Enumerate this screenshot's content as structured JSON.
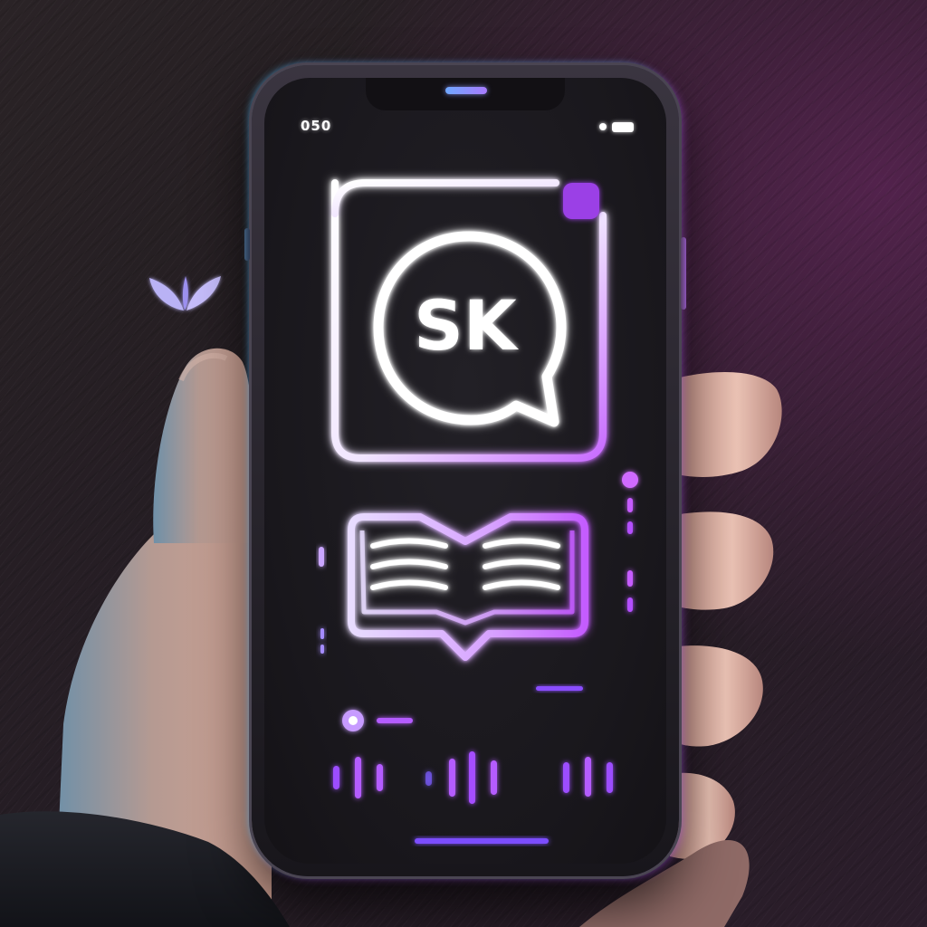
{
  "status_bar": {
    "time": "050"
  },
  "app_icon": {
    "logo_text": "SK",
    "icon": "chat-bubble-icon"
  },
  "content": {
    "icon": "open-book-chat-icon"
  },
  "audio": {
    "icon": "audio-waveform-icon"
  },
  "colors": {
    "neon_white": "#ffffff",
    "neon_purple": "#b45cff",
    "neon_violet": "#8a4dff",
    "neon_blue": "#6fa8ff",
    "background": "#231d21"
  },
  "brand": {
    "icon": "leaf-logo-icon"
  }
}
